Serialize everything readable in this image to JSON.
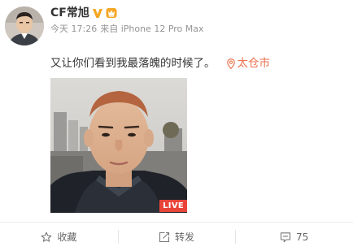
{
  "post": {
    "username": "CF常旭",
    "timestamp": "今天 17:26",
    "source": "来自 iPhone 12 Pro Max",
    "text": "又让你们看到我最落魄的时候了。",
    "location": "太仓市",
    "live_label": "LIVE"
  },
  "actions": {
    "favorite_label": "收藏",
    "repost_label": "转发",
    "comment_count": "75"
  },
  "colors": {
    "accent": "#eb7350",
    "verified": "#f5a623",
    "live": "#e8443a"
  },
  "icons": {
    "verified": "verified-v-icon",
    "vip": "vip-crown-icon",
    "location": "location-pin-icon",
    "favorite": "star-icon",
    "repost": "repost-icon",
    "comment": "comment-icon"
  }
}
